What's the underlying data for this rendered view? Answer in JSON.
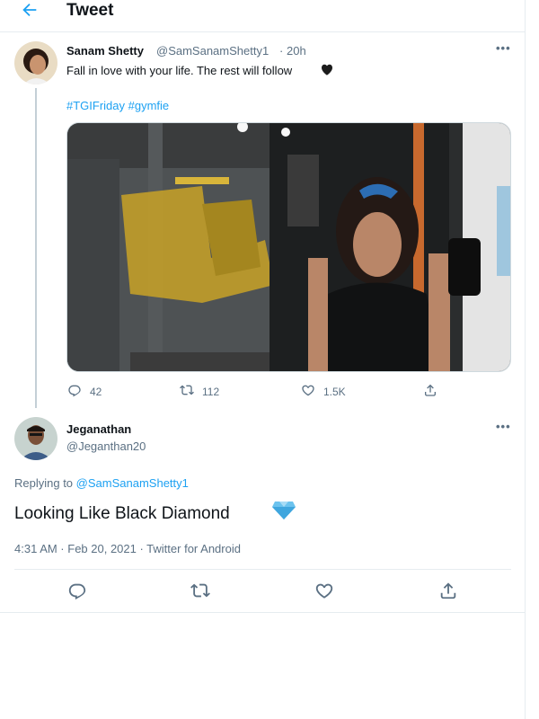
{
  "header": {
    "title": "Tweet"
  },
  "tweet": {
    "author_name": "Sanam Shetty",
    "author_handle": "@SamSanamShetty1",
    "separator": "·",
    "time": "20h",
    "text": "Fall in love with your life. The rest will follow",
    "hashtags": "#TGIFriday #gymfie",
    "counts": {
      "replies": "42",
      "retweets": "112",
      "likes": "1.5K"
    }
  },
  "reply": {
    "author_name": "Jeganathan",
    "author_handle": "@Jeganthan20",
    "replying_to_label": "Replying to",
    "replying_to_handle": "@SamSanamShetty1",
    "text": "Looking Like Black Diamond",
    "date": "4:31 AM · Feb 20, 2021 · Twitter for Android"
  },
  "icons": [
    "arrow-left-icon",
    "more-icon",
    "black-heart-emoji",
    "reply-icon",
    "retweet-icon",
    "like-icon",
    "share-icon",
    "diamond-emoji"
  ],
  "colors": {
    "accent": "#1da1f2",
    "muted": "#5b7083",
    "border": "#e6ecf0"
  }
}
